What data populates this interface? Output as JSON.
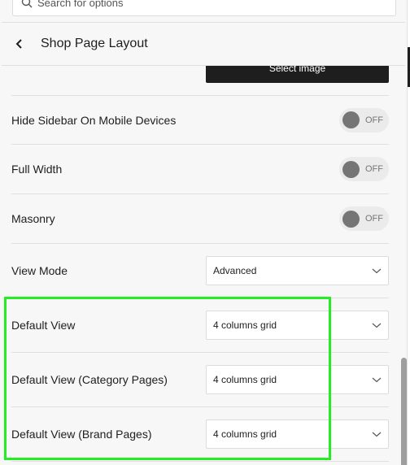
{
  "search": {
    "placeholder": "Search for options",
    "icon": "search-icon"
  },
  "header": {
    "back_icon": "chevron-left-icon",
    "title": "Shop Page Layout"
  },
  "select_image_button": {
    "label": "Select image"
  },
  "settings": [
    {
      "label": "Hide Sidebar On Mobile Devices",
      "type": "toggle",
      "state": "OFF"
    },
    {
      "label": "Full Width",
      "type": "toggle",
      "state": "OFF"
    },
    {
      "label": "Masonry",
      "type": "toggle",
      "state": "OFF"
    },
    {
      "label": "View Mode",
      "type": "select",
      "value": "Advanced"
    },
    {
      "label": "Default View",
      "type": "select",
      "value": "4 columns grid"
    },
    {
      "label": "Default View (Category Pages)",
      "type": "select",
      "value": "4 columns grid"
    },
    {
      "label": "Default View (Brand Pages)",
      "type": "select",
      "value": "4 columns grid"
    }
  ],
  "colors": {
    "highlight": "#22ee22",
    "button_dark": "#1e1e1e",
    "toggle_knob": "#757575"
  }
}
